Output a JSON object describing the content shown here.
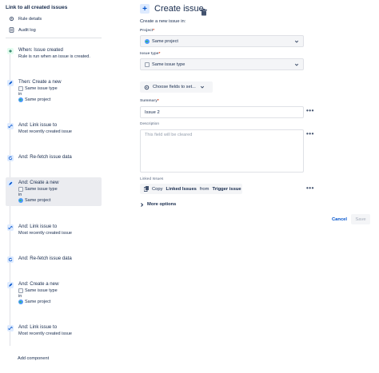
{
  "sidebar": {
    "rule_title": "Link to all created issues",
    "menu": [
      {
        "label": "Rule details",
        "icon": "settings-icon"
      },
      {
        "label": "Audit log",
        "icon": "list-icon"
      }
    ],
    "steps": [
      {
        "kind": "trigger",
        "icon": "plus-icon",
        "title": "When: Issue created",
        "lines": [
          {
            "text": "Rule is run when an issue is created.",
            "icon": ""
          }
        ]
      },
      {
        "kind": "action",
        "icon": "edit-icon",
        "title": "Then: Create a new",
        "lines": [
          {
            "text": "Same issue type",
            "icon": "issue-type-icon"
          },
          {
            "text": "in",
            "icon": ""
          },
          {
            "text": "Same project",
            "icon": "project-icon"
          }
        ]
      },
      {
        "kind": "action",
        "icon": "link-icon",
        "title": "And: Link issue to",
        "lines": [
          {
            "text": "Most recently created issue",
            "icon": ""
          }
        ]
      },
      {
        "kind": "refetch",
        "icon": "refresh-icon",
        "title": "And: Re-fetch issue data",
        "lines": []
      },
      {
        "kind": "action",
        "icon": "edit-icon",
        "title": "And: Create a new",
        "lines": [
          {
            "text": "Same issue type",
            "icon": "issue-type-icon"
          },
          {
            "text": "in",
            "icon": ""
          },
          {
            "text": "Same project",
            "icon": "project-icon"
          }
        ]
      },
      {
        "kind": "action",
        "icon": "link-icon",
        "title": "And: Link issue to",
        "lines": [
          {
            "text": "Most recently created issue",
            "icon": ""
          }
        ]
      },
      {
        "kind": "refetch",
        "icon": "refresh-icon",
        "title": "And: Re-fetch issue data",
        "lines": []
      },
      {
        "kind": "action",
        "icon": "edit-icon",
        "title": "And: Create a new",
        "lines": [
          {
            "text": "Same issue type",
            "icon": "issue-type-icon"
          },
          {
            "text": "in",
            "icon": ""
          },
          {
            "text": "Same project",
            "icon": "project-icon"
          }
        ]
      },
      {
        "kind": "action",
        "icon": "link-icon",
        "title": "And: Link issue to",
        "lines": [
          {
            "text": "Most recently created issue",
            "icon": ""
          }
        ]
      }
    ],
    "add_component": "Add component"
  },
  "editor": {
    "title": "Create issue",
    "subheading": "Create a new issue in:",
    "project": {
      "label": "Project",
      "required_mark": "*",
      "value": "Same project",
      "icon": "project-icon"
    },
    "issue_type": {
      "label": "Issue type",
      "required_mark": "*",
      "value": "Same issue type",
      "icon": "issue-type-icon"
    },
    "choose_fields": "Choose fields to set...",
    "summary": {
      "label": "Summary",
      "required_mark": "*",
      "value": "Issue 2"
    },
    "description": {
      "label": "Description",
      "placeholder": "This field will be cleared"
    },
    "linked_issues": {
      "label": "Linked Issues",
      "text_pre": "Copy",
      "text_bold1": "Linked Issues",
      "text_mid": "from",
      "text_bold2": "Trigger issue"
    },
    "more_options": "More options",
    "cancel": "Cancel",
    "save": "Save",
    "colors": {
      "accent": "#0052cc",
      "required": "#de350b"
    }
  }
}
